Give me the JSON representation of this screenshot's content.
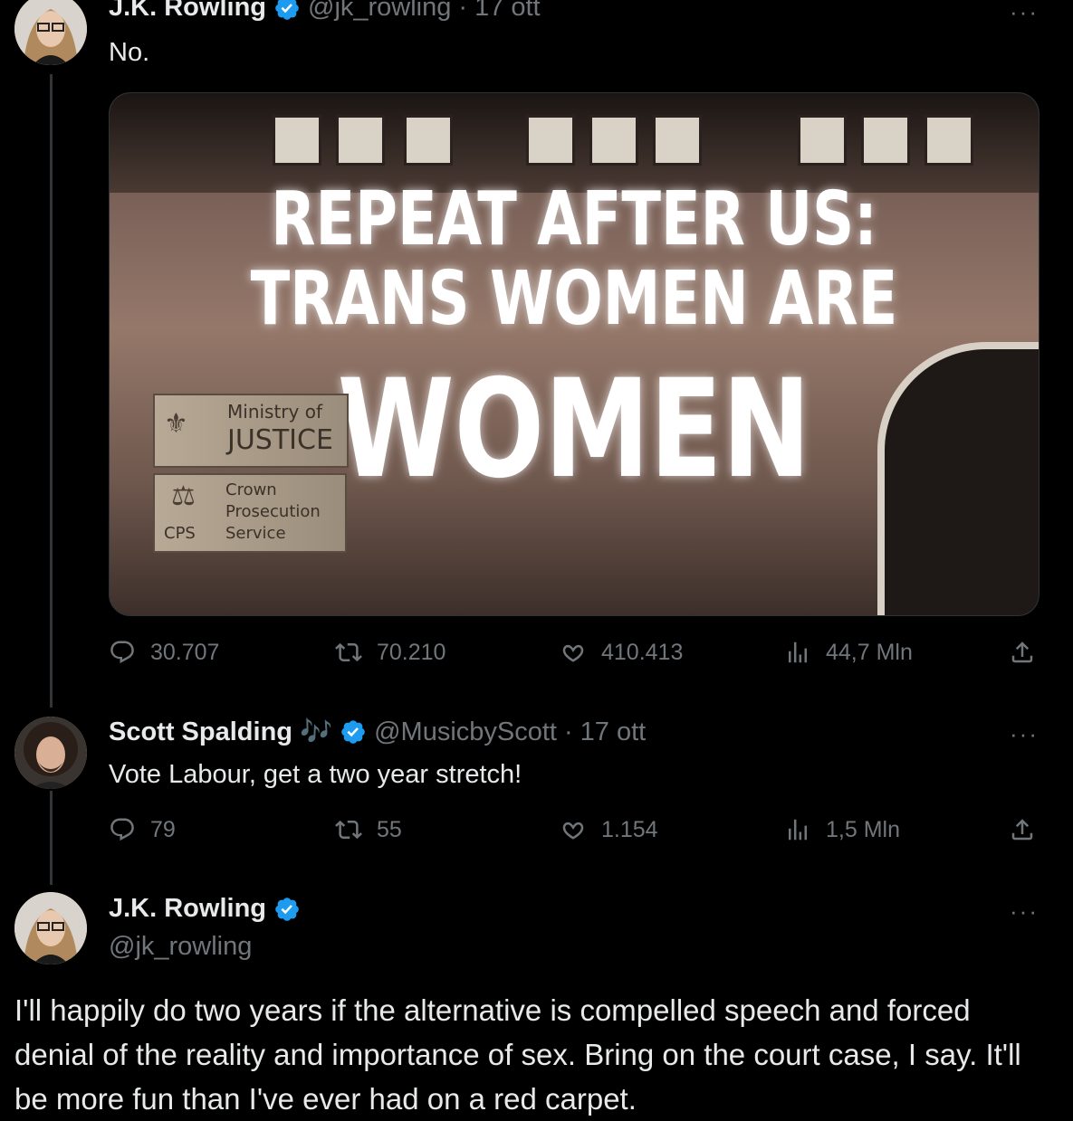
{
  "colors": {
    "background": "#000000",
    "text": "#e7e9ea",
    "muted": "#71767b",
    "verified": "#1d9bf0"
  },
  "tweet1": {
    "name": "J.K. Rowling",
    "handle": "@jk_rowling",
    "separator": "·",
    "date": "17 ott",
    "text": "No.",
    "more_label": "···",
    "image": {
      "projection_line1": "REPEAT AFTER US:",
      "projection_line2": "TRANS WOMEN ARE",
      "projection_line3": "WOMEN",
      "sign1_line1": "Ministry of",
      "sign1_line2": "JUSTICE",
      "sign2_line1": "Crown",
      "sign2_line2": "Prosecution",
      "sign2_line3": "Service",
      "sign2_abbr": "CPS"
    },
    "stats": {
      "replies": "30.707",
      "reposts": "70.210",
      "likes": "410.413",
      "views": "44,7 Mln"
    }
  },
  "tweet2": {
    "name": "Scott Spalding",
    "name_emoji": "🎶",
    "handle": "@MusicbyScott",
    "separator": "·",
    "date": "17 ott",
    "text": "Vote Labour, get a two year stretch!",
    "more_label": "···",
    "stats": {
      "replies": "79",
      "reposts": "55",
      "likes": "1.154",
      "views": "1,5 Mln"
    }
  },
  "tweet3": {
    "name": "J.K. Rowling",
    "handle": "@jk_rowling",
    "more_label": "···",
    "text": "I'll happily do two years if the alternative is compelled speech and forced denial of the reality and importance of sex. Bring on the court case, I say. It'll be more fun than I've ever had on a red carpet."
  }
}
